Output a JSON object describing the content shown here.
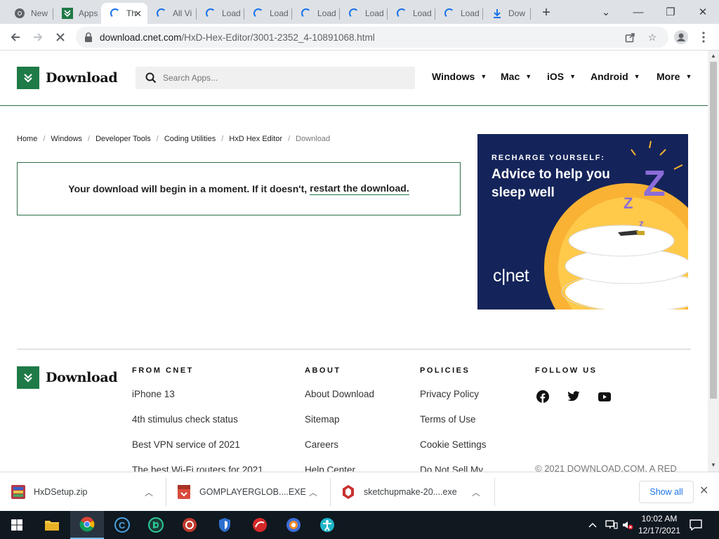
{
  "browser": {
    "tabs": [
      {
        "label": "New",
        "icon": "chrome-icon"
      },
      {
        "label": "Apps",
        "icon": "download-site-icon"
      },
      {
        "label": "Th",
        "icon": "loading-spinner-icon",
        "active": true
      },
      {
        "label": "All Vi",
        "icon": "loading-spinner-icon"
      },
      {
        "label": "Load",
        "icon": "loading-spinner-icon"
      },
      {
        "label": "Load",
        "icon": "loading-spinner-icon"
      },
      {
        "label": "Load",
        "icon": "loading-spinner-icon"
      },
      {
        "label": "Load",
        "icon": "loading-spinner-icon"
      },
      {
        "label": "Load",
        "icon": "loading-spinner-icon"
      },
      {
        "label": "Load",
        "icon": "loading-spinner-icon"
      },
      {
        "label": "Dow",
        "icon": "download-arrow-icon"
      }
    ],
    "url_host": "download.cnet.com",
    "url_path": "/HxD-Hex-Editor/3001-2352_4-10891068.html"
  },
  "site": {
    "logo_text": "Download",
    "search_placeholder": "Search Apps...",
    "nav": [
      "Windows",
      "Mac",
      "iOS",
      "Android",
      "More"
    ],
    "breadcrumbs": [
      "Home",
      "Windows",
      "Developer Tools",
      "Coding Utilities",
      "HxD Hex Editor",
      "Download"
    ],
    "notice_text": "Your download will begin in a moment. If it doesn't,",
    "notice_link": "restart the download."
  },
  "ad": {
    "kicker": "RECHARGE YOURSELF:",
    "headline": "Advice to help you sleep well",
    "brand": "c|net",
    "colors": {
      "background": "#14245a",
      "sun": "#f9b233",
      "z": "#8b6cd9"
    }
  },
  "footer": {
    "logo_text": "Download",
    "columns": [
      {
        "heading": "FROM CNET",
        "links": [
          "iPhone 13",
          "4th stimulus check status",
          "Best VPN service of 2021",
          "The best Wi-Fi routers for 2021"
        ]
      },
      {
        "heading": "ABOUT",
        "links": [
          "About Download",
          "Sitemap",
          "Careers",
          "Help Center"
        ]
      },
      {
        "heading": "POLICIES",
        "links": [
          "Privacy Policy",
          "Terms of Use",
          "Cookie Settings",
          "Do Not Sell My"
        ]
      },
      {
        "heading": "FOLLOW US",
        "links": []
      }
    ],
    "social_icons": [
      "facebook-icon",
      "twitter-icon",
      "youtube-icon"
    ],
    "copyright": "© 2021 DOWNLOAD.COM, A RED"
  },
  "downloads": {
    "items": [
      "HxDSetup.zip",
      "GOMPLAYERGLOB....EXE",
      "sketchupmake-20....exe"
    ],
    "show_all": "Show all"
  },
  "taskbar": {
    "time": "10:02 AM",
    "date": "12/17/2021"
  },
  "colors": {
    "brand_green": "#1e7a46",
    "chrome_tab_strip": "#dee1e6",
    "link_blue": "#1a73e8"
  }
}
